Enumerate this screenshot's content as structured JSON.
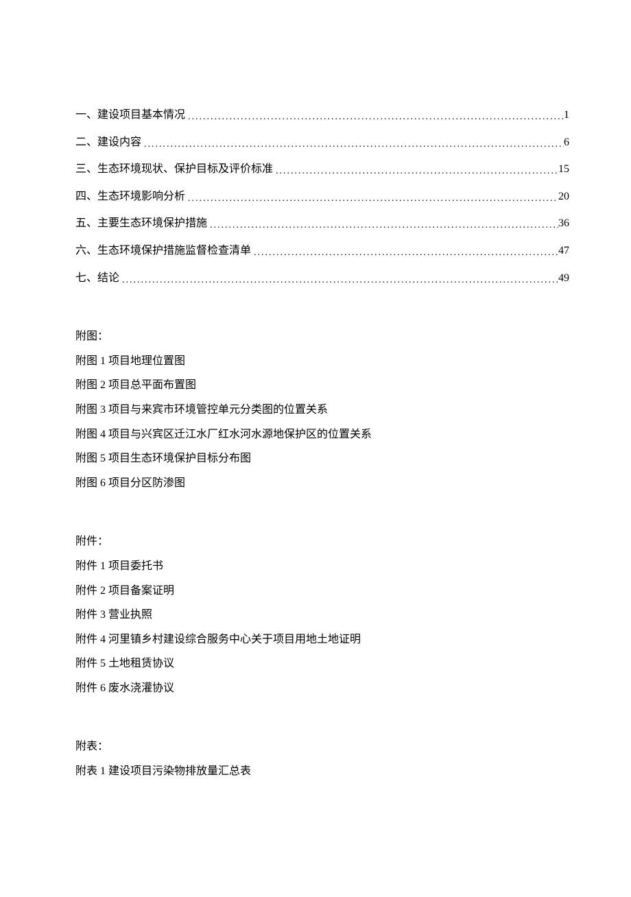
{
  "toc": {
    "items": [
      {
        "label": "一、建设项目基本情况",
        "page": "1"
      },
      {
        "label": "二、建设内容",
        "page": "6"
      },
      {
        "label": "三、生态环境现状、保护目标及评价标准 ",
        "page": "15"
      },
      {
        "label": "四、生态环境影响分析 ",
        "page": "20"
      },
      {
        "label": "五、主要生态环境保护措施 ",
        "page": "36"
      },
      {
        "label": "六、生态环境保护措施监督检查清单 ",
        "page": "47"
      },
      {
        "label": "七、结论 ",
        "page": "49"
      }
    ]
  },
  "figures": {
    "heading": "附图：",
    "items": [
      "附图 1 项目地理位置图",
      "附图 2 项目总平面布置图",
      "附图 3 项目与来宾市环境管控单元分类图的位置关系",
      "附图 4 项目与兴宾区迁江水厂红水河水源地保护区的位置关系",
      "附图 5 项目生态环境保护目标分布图",
      "附图 6 项目分区防渗图"
    ]
  },
  "attachments": {
    "heading": "附件：",
    "items": [
      "附件 1 项目委托书",
      "附件 2 项目备案证明",
      "附件 3 营业执照",
      "附件 4 河里镇乡村建设综合服务中心关于项目用地土地证明",
      "附件 5 土地租赁协议",
      "附件 6 废水浇灌协议"
    ]
  },
  "tables": {
    "heading": "附表：",
    "items": [
      "附表 1 建设项目污染物排放量汇总表"
    ]
  }
}
